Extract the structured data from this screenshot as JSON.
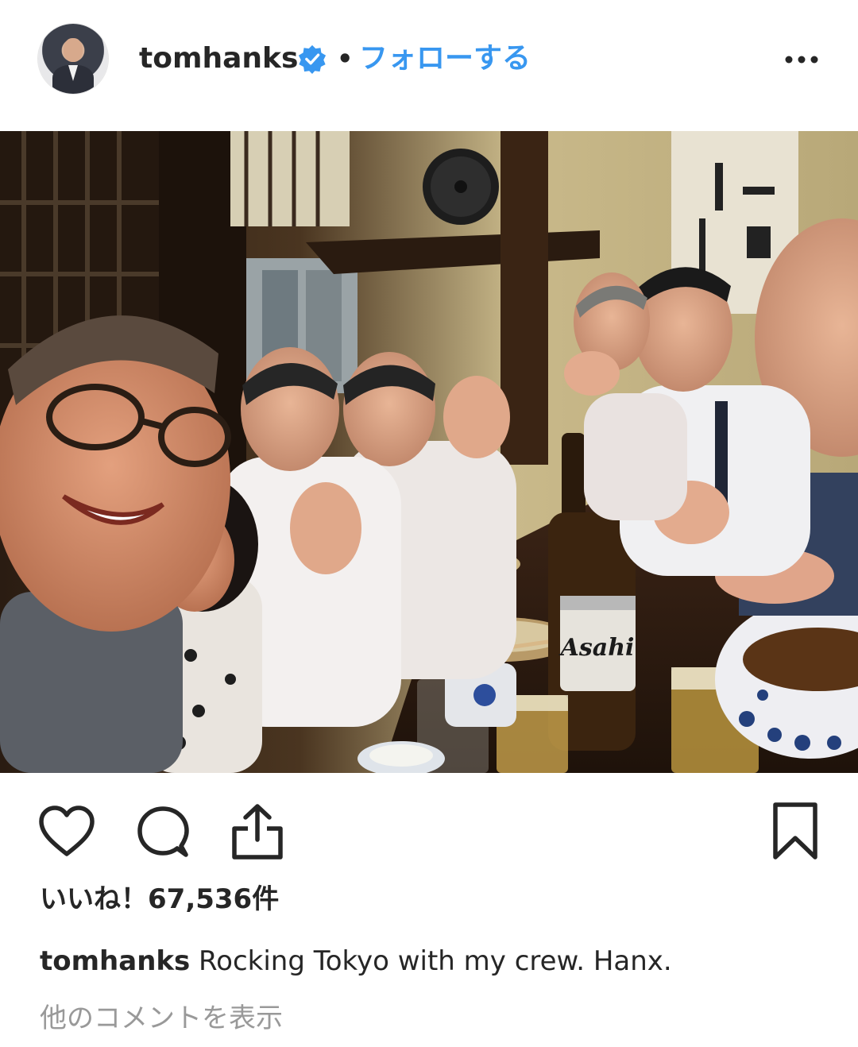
{
  "post": {
    "username": "tomhanks",
    "separator": "•",
    "follow_label": "フォローする",
    "likes_text": "いいね！67,536件",
    "caption_user": "tomhanks",
    "caption_text": " Rocking Tokyo with my crew. Hanx.",
    "view_comments": "他のコメントを表示"
  },
  "colors": {
    "accent": "#3897f0",
    "text": "#262626",
    "muted": "#999999"
  },
  "icons": {
    "verified": "verified-badge-icon",
    "more": "more-options-icon",
    "like": "heart-icon",
    "comment": "comment-icon",
    "share": "share-icon",
    "save": "bookmark-icon"
  }
}
